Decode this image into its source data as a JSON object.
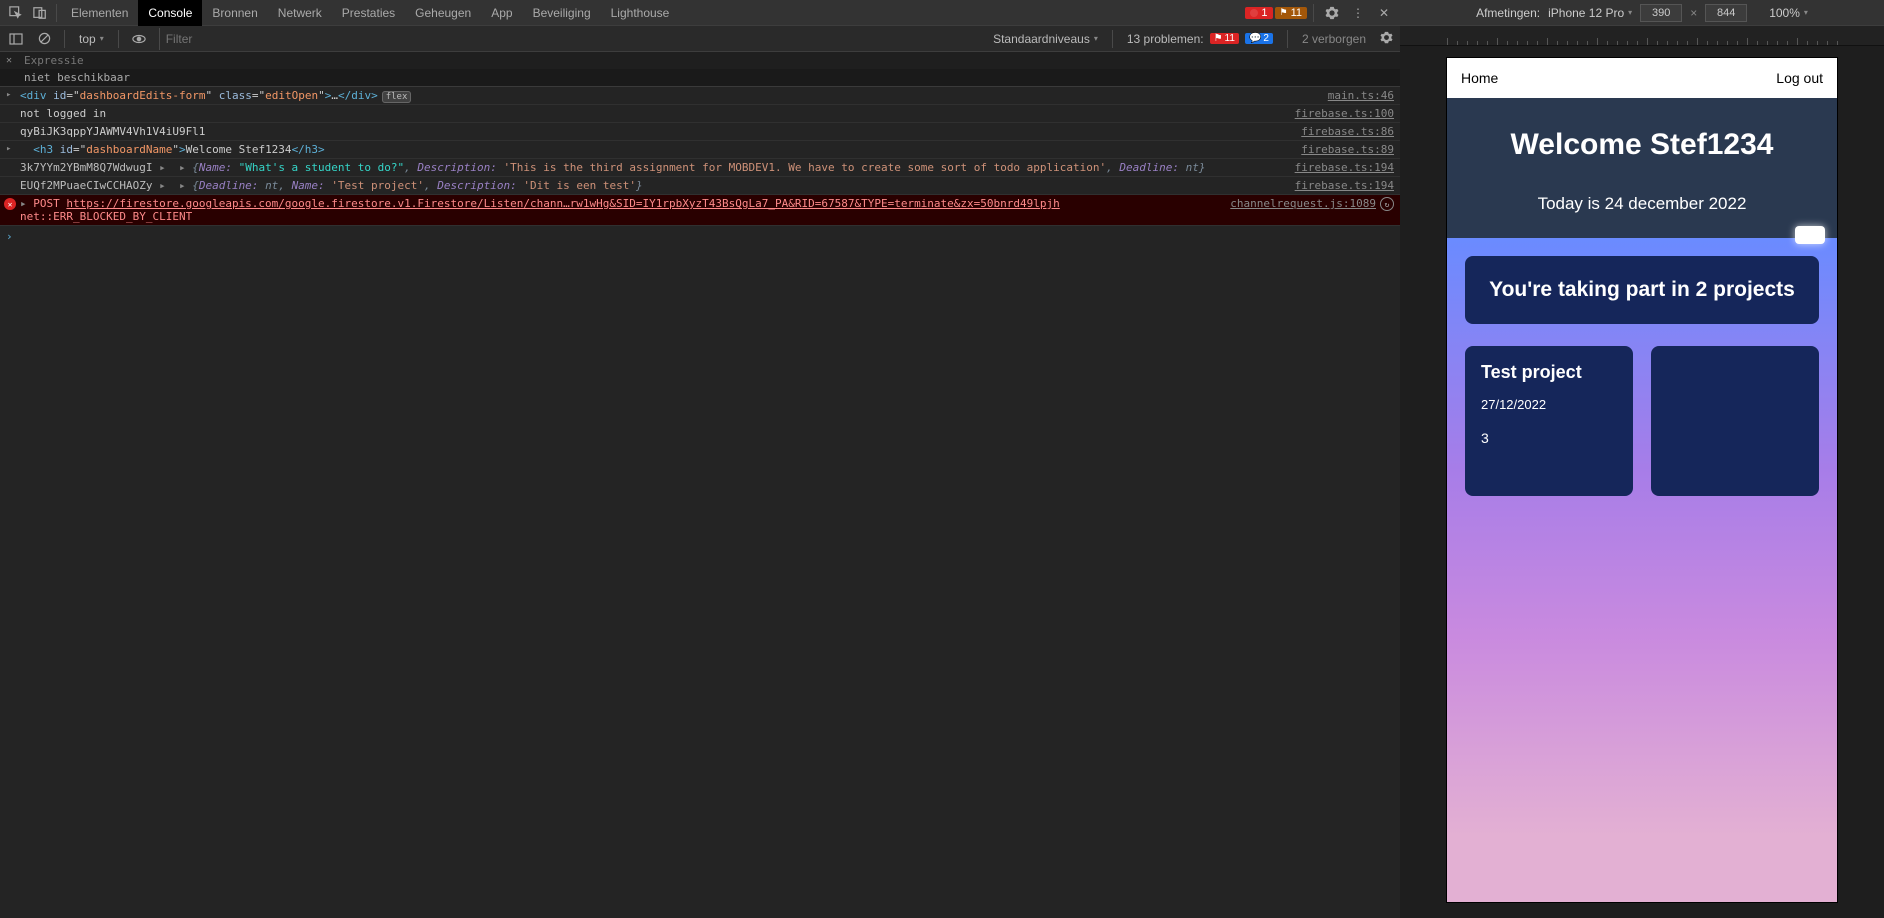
{
  "tabs": [
    "Elementen",
    "Console",
    "Bronnen",
    "Netwerk",
    "Prestaties",
    "Geheugen",
    "App",
    "Beveiliging",
    "Lighthouse"
  ],
  "active_tab": "Console",
  "badges": {
    "errors": "1",
    "warnings": "11"
  },
  "sub": {
    "context": "top",
    "filter_placeholder": "Filter",
    "level": "Standaardniveaus",
    "problems_label": "13 problemen:",
    "prob_err": "11",
    "prob_info": "2",
    "hidden": "2 verborgen"
  },
  "expr": {
    "label": "Expressie",
    "result": "niet beschikbaar"
  },
  "logs": [
    {
      "type": "html",
      "arrow": true,
      "source": "main.ts:46",
      "segments": [
        {
          "t": "tag",
          "v": "<div "
        },
        {
          "t": "attr",
          "v": "id"
        },
        {
          "t": "plain",
          "v": "=\""
        },
        {
          "t": "str",
          "v": "dashboardEdits-form"
        },
        {
          "t": "plain",
          "v": "\" "
        },
        {
          "t": "attr",
          "v": "class"
        },
        {
          "t": "plain",
          "v": "=\""
        },
        {
          "t": "str",
          "v": "editOpen"
        },
        {
          "t": "plain",
          "v": "\""
        },
        {
          "t": "tag",
          "v": ">"
        },
        {
          "t": "plain",
          "v": "…"
        },
        {
          "t": "tag",
          "v": "</div>"
        }
      ],
      "flex_badge": "flex"
    },
    {
      "type": "plain",
      "source": "firebase.ts:100",
      "text": "not logged in"
    },
    {
      "type": "plain",
      "source": "firebase.ts:86",
      "text": "qyBiJK3qppYJAWMV4Vh1V4iU9Fl1"
    },
    {
      "type": "html",
      "indent": true,
      "source": "firebase.ts:89",
      "segments": [
        {
          "t": "tag",
          "v": "<h3 "
        },
        {
          "t": "attr",
          "v": "id"
        },
        {
          "t": "plain",
          "v": "=\""
        },
        {
          "t": "str",
          "v": "dashboardName"
        },
        {
          "t": "plain",
          "v": "\""
        },
        {
          "t": "tag",
          "v": ">"
        },
        {
          "t": "plain",
          "v": "Welcome Stef1234"
        },
        {
          "t": "tag",
          "v": "</h3>"
        }
      ]
    },
    {
      "type": "obj",
      "prefix": "3k7YYm2YBmM8Q7WdwugI",
      "source": "firebase.ts:194",
      "segments": [
        {
          "t": "ital",
          "v": "{"
        },
        {
          "t": "key",
          "v": "Name: "
        },
        {
          "t": "val",
          "v": "\"What's a student to do?\""
        },
        {
          "t": "ital",
          "v": ", "
        },
        {
          "t": "key",
          "v": "Description: "
        },
        {
          "t": "str2",
          "v": "'This is the third assignment for MOBDEV1. We have to create some sort of todo application'"
        },
        {
          "t": "ital",
          "v": ", "
        },
        {
          "t": "key",
          "v": "Deadline: "
        },
        {
          "t": "ital",
          "v": "nt"
        },
        {
          "t": "ital",
          "v": "}"
        }
      ]
    },
    {
      "type": "obj",
      "prefix": "EUQf2MPuaeCIwCCHAOZy",
      "source": "firebase.ts:194",
      "segments": [
        {
          "t": "ital",
          "v": "{"
        },
        {
          "t": "key",
          "v": "Deadline: "
        },
        {
          "t": "ital",
          "v": "nt"
        },
        {
          "t": "ital",
          "v": ", "
        },
        {
          "t": "key",
          "v": "Name: "
        },
        {
          "t": "str2",
          "v": "'Test project'"
        },
        {
          "t": "ital",
          "v": ", "
        },
        {
          "t": "key",
          "v": "Description: "
        },
        {
          "t": "str2",
          "v": "'Dit is een test'"
        },
        {
          "t": "ital",
          "v": "}"
        }
      ]
    },
    {
      "type": "error",
      "source": "channelrequest.js:1089",
      "method": "POST",
      "url": "https://firestore.googleapis.com/google.firestore.v1.Firestore/Listen/chann…rw1wHg&SID=IY1rpbXyzT43BsQgLa7_PA&RID=67587&TYPE=terminate&zx=50bnrd49lpjh",
      "sub": "net::ERR_BLOCKED_BY_CLIENT"
    }
  ],
  "device": {
    "dim_label": "Afmetingen:",
    "device_name": "iPhone 12 Pro",
    "w": "390",
    "h": "844",
    "zoom": "100%"
  },
  "app": {
    "nav_home": "Home",
    "nav_logout": "Log out",
    "welcome": "Welcome Stef1234",
    "today": "Today is 24 december 2022",
    "banner": "You're taking part in 2 projects",
    "card": {
      "title": "Test project",
      "date": "27/12/2022",
      "num": "3"
    }
  }
}
